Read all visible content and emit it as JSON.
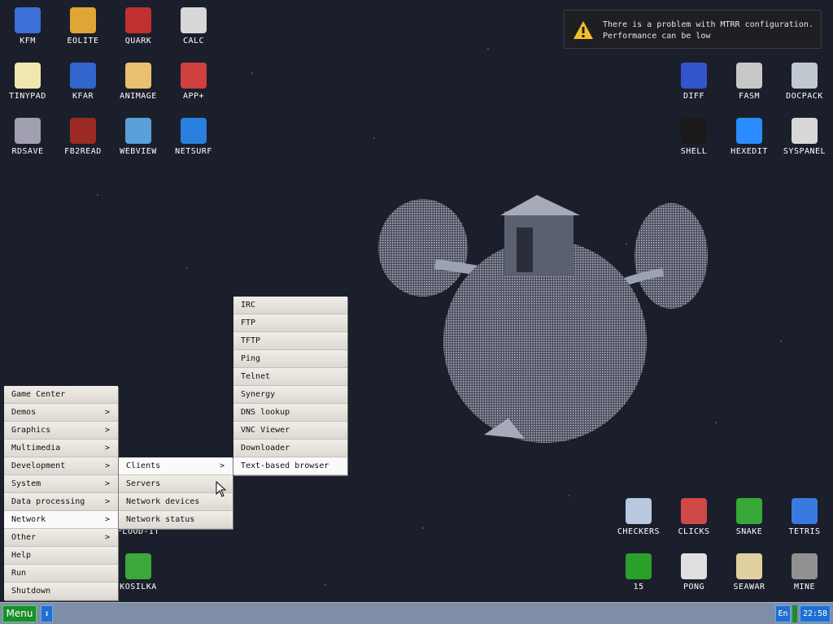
{
  "desktop_icons_left": [
    {
      "label": "KFM",
      "icon": "floppy-icon",
      "color": "#3d6fd8"
    },
    {
      "label": "EOLITE",
      "icon": "folder-icon",
      "color": "#e0a635"
    },
    {
      "label": "QUARK",
      "icon": "notebook-icon",
      "color": "#c03030"
    },
    {
      "label": "CALC",
      "icon": "calculator-icon",
      "color": "#d8d8d8"
    },
    {
      "label": "TINYPAD",
      "icon": "notepad-icon",
      "color": "#f0e6b0"
    },
    {
      "label": "KFAR",
      "icon": "panels-icon",
      "color": "#3366cc"
    },
    {
      "label": "ANIMAGE",
      "icon": "pencil-ruler-icon",
      "color": "#e8c070"
    },
    {
      "label": "APP+",
      "icon": "rubik-cube-icon",
      "color": "#d04040"
    },
    {
      "label": "RDSAVE",
      "icon": "ram-save-icon",
      "color": "#a0a0b0"
    },
    {
      "label": "FB2READ",
      "icon": "book-icon",
      "color": "#9b2b22"
    },
    {
      "label": "WEBVIEW",
      "icon": "web-page-icon",
      "color": "#5aa0d8"
    },
    {
      "label": "NETSURF",
      "icon": "globe-icon",
      "color": "#2a80e0"
    }
  ],
  "desktop_icons_right": [
    {
      "label": "DIFF",
      "icon": "diff-icon",
      "color": "#3355cc"
    },
    {
      "label": "FASM",
      "icon": "assembler-icon",
      "color": "#c8c8c8"
    },
    {
      "label": "DOCPACK",
      "icon": "cabinet-icon",
      "color": "#c0c8d0"
    },
    {
      "label": "SHELL",
      "icon": "terminal-icon",
      "color": "#1a1a1a"
    },
    {
      "label": "HEXEDIT",
      "icon": "hex-editor-icon",
      "color": "#2a8cff"
    },
    {
      "label": "SYSPANEL",
      "icon": "sliders-icon",
      "color": "#d8d8d8"
    }
  ],
  "desktop_icons_bottom": [
    {
      "label": "CHECKERS",
      "icon": "checkers-icon",
      "color": "#b8c8e0"
    },
    {
      "label": "CLICKS",
      "icon": "blocks-icon",
      "color": "#d04848"
    },
    {
      "label": "SNAKE",
      "icon": "snake-icon",
      "color": "#38a838"
    },
    {
      "label": "TETRIS",
      "icon": "tetris-icon",
      "color": "#3a7ae0"
    },
    {
      "label": "15",
      "icon": "puzzle-15-icon",
      "color": "#2aa02a"
    },
    {
      "label": "PONG",
      "icon": "pong-icon",
      "color": "#e0e0e0"
    },
    {
      "label": "SEAWAR",
      "icon": "battleship-icon",
      "color": "#e0d0a0"
    },
    {
      "label": "MINE",
      "icon": "mine-icon",
      "color": "#909090"
    },
    {
      "label": "FLOOD-IT",
      "icon": "flood-icon",
      "color": "#404040"
    },
    {
      "label": "KOSILKA",
      "icon": "lawnmower-icon",
      "color": "#3aa83a"
    }
  ],
  "notification": {
    "line1": "There is a problem with MTRR configuration.",
    "line2": "Performance can be low",
    "icon": "warning-icon",
    "icon_color": "#f2c02a"
  },
  "main_menu": [
    {
      "label": "Game Center",
      "submenu": false
    },
    {
      "label": "Demos",
      "submenu": true
    },
    {
      "label": "Graphics",
      "submenu": true
    },
    {
      "label": "Multimedia",
      "submenu": true
    },
    {
      "label": "Development",
      "submenu": true
    },
    {
      "label": "System",
      "submenu": true
    },
    {
      "label": "Data processing",
      "submenu": true
    },
    {
      "label": "Network",
      "submenu": true,
      "active": true
    },
    {
      "label": "Other",
      "submenu": true
    },
    {
      "label": "Help",
      "submenu": false
    },
    {
      "label": "Run",
      "submenu": false
    },
    {
      "label": "Shutdown",
      "submenu": false
    }
  ],
  "network_menu": [
    {
      "label": "Clients",
      "submenu": true,
      "active": true
    },
    {
      "label": "Servers",
      "submenu": false
    },
    {
      "label": "Network devices",
      "submenu": false
    },
    {
      "label": "Network status",
      "submenu": false
    }
  ],
  "clients_menu": [
    {
      "label": "IRC"
    },
    {
      "label": "FTP"
    },
    {
      "label": "TFTP"
    },
    {
      "label": "Ping"
    },
    {
      "label": "Telnet"
    },
    {
      "label": "Synergy"
    },
    {
      "label": "DNS lookup"
    },
    {
      "label": "VNC Viewer"
    },
    {
      "label": "Downloader"
    },
    {
      "label": "Text-based browser",
      "active": true
    }
  ],
  "submenu_arrow": ">",
  "taskbar": {
    "menu_label": "Menu",
    "switch_icon": "updown-arrow-icon",
    "lang_label": "En",
    "clock": "22:58",
    "bar_color": "#7e8ea7"
  }
}
